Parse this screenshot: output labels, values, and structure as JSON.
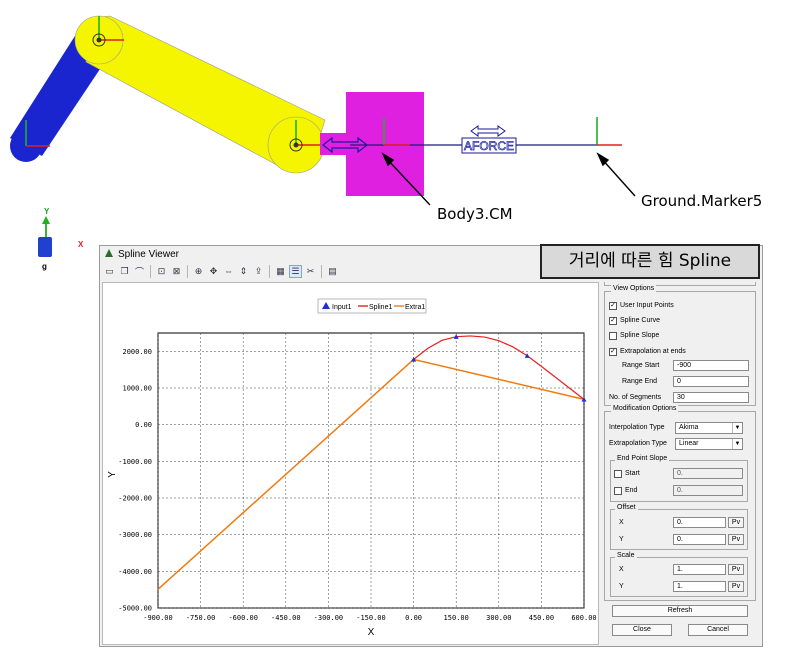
{
  "callouts": {
    "body3": "Body3.CM",
    "ground": "Ground.Marker5"
  },
  "mechanism_labels": {
    "aforce": "AFORCE"
  },
  "triad": {
    "y": "Y",
    "x": "X",
    "g": "g"
  },
  "overlay_title": "거리에 따른 힘 Spline",
  "window": {
    "title": "Spline Viewer",
    "toolbar_icons": [
      "open-icon",
      "copy-icon",
      "plot-icon",
      "zoom-fit-icon",
      "zoom-box-icon",
      "zoom-in-icon",
      "pan-icon",
      "flip-h-icon",
      "flip-v-icon",
      "export-icon",
      "grid-icon",
      "table-icon",
      "settings-icon",
      "help-icon"
    ]
  },
  "chart_data": {
    "type": "line",
    "legend": [
      "Input1",
      "Spline1",
      "Extra1"
    ],
    "xlabel": "X",
    "ylabel": "Y",
    "xlim": [
      -900,
      600
    ],
    "ylim": [
      -5000,
      2500
    ],
    "x_ticks": [
      "-900.00",
      "-750.00",
      "-600.00",
      "-450.00",
      "-300.00",
      "-150.00",
      "0.00",
      "150.00",
      "300.00",
      "450.00",
      "600.00"
    ],
    "y_ticks": [
      "2000.00",
      "1000.00",
      "0.00",
      "-1000.00",
      "-2000.00",
      "-3000.00",
      "-4000.00",
      "-5000.00"
    ],
    "series": [
      {
        "name": "Input1",
        "points": [
          [
            0,
            1780
          ],
          [
            150,
            2400
          ],
          [
            400,
            1880
          ],
          [
            600,
            690
          ]
        ]
      },
      {
        "name": "Spline1",
        "points": [
          [
            0,
            1780
          ],
          [
            50,
            2080
          ],
          [
            100,
            2300
          ],
          [
            150,
            2400
          ],
          [
            200,
            2420
          ],
          [
            250,
            2390
          ],
          [
            300,
            2290
          ],
          [
            350,
            2120
          ],
          [
            400,
            1880
          ],
          [
            450,
            1590
          ],
          [
            500,
            1290
          ],
          [
            550,
            990
          ],
          [
            600,
            690
          ]
        ]
      },
      {
        "name": "Extra1",
        "points": [
          [
            -900,
            -4490
          ],
          [
            0,
            1780
          ],
          [
            600,
            690
          ]
        ]
      }
    ],
    "colors": {
      "Input1": "#1f2fd0",
      "Spline1": "#e62020",
      "Extra1": "#f07a10"
    }
  },
  "panel": {
    "view_options": {
      "title": "View Options",
      "user_input_points": "User Input Points",
      "spline_curve": "Spline Curve",
      "spline_slope": "Spline Slope",
      "extrapolation_at_ends": "Extrapolation at ends",
      "range_start_label": "Range Start",
      "range_start": "-900",
      "range_end_label": "Range End",
      "range_end": "0",
      "segments_label": "No. of Segments",
      "segments": "30"
    },
    "modification": {
      "title": "Modification Options",
      "interp_label": "Interpolation Type",
      "interp_value": "Akima",
      "extrap_label": "Extrapolation Type",
      "extrap_value": "Linear",
      "end_slope_title": "End Point Slope",
      "start_label": "Start",
      "start_value": "0.",
      "end_label": "End",
      "end_value": "0.",
      "offset_title": "Offset",
      "offset_x_label": "X",
      "offset_x": "0.",
      "offset_y_label": "Y",
      "offset_y": "0.",
      "scale_title": "Scale",
      "scale_x_label": "X",
      "scale_x": "1.",
      "scale_y_label": "Y",
      "scale_y": "1.",
      "pv": "Pv"
    },
    "refresh": "Refresh",
    "close": "Close",
    "cancel": "Cancel"
  }
}
